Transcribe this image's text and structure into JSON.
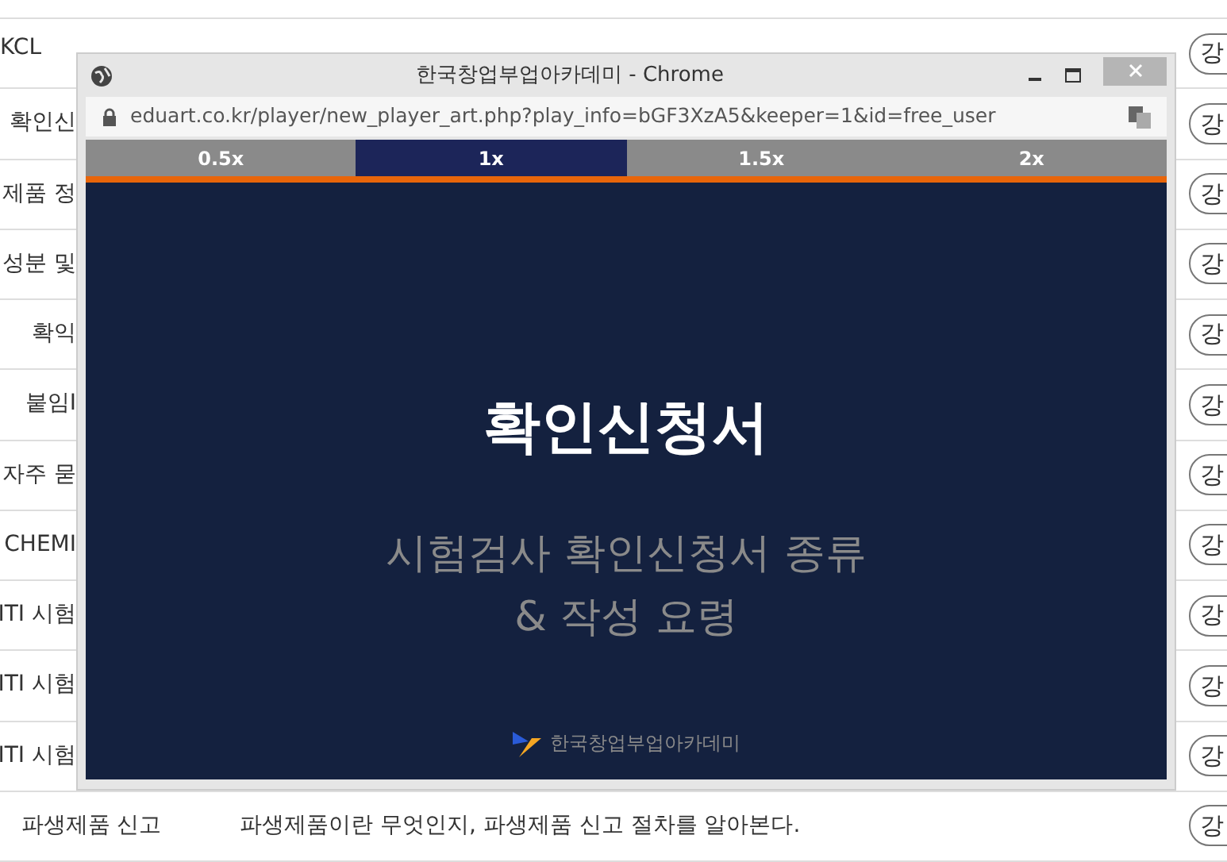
{
  "lessons": [
    {
      "kind": "partial",
      "title": "KCL",
      "button": "강"
    },
    {
      "kind": "covered",
      "title": "확인신",
      "button": "강"
    },
    {
      "kind": "covered",
      "title": "제품 정",
      "button": "강"
    },
    {
      "kind": "covered",
      "title": "성분 및",
      "button": "강"
    },
    {
      "kind": "covered",
      "title": "확익",
      "button": "강"
    },
    {
      "kind": "covered",
      "title": "붙임I",
      "button": "강"
    },
    {
      "kind": "covered",
      "title": "자주 묻",
      "button": "강"
    },
    {
      "kind": "covered",
      "title": "CHEMI",
      "button": "강"
    },
    {
      "kind": "covered",
      "title": "ITI 시험",
      "button": "강"
    },
    {
      "kind": "covered",
      "title": "ITI 시험",
      "button": "강"
    },
    {
      "kind": "covered",
      "title": "ITI 시험",
      "button": "강"
    },
    {
      "kind": "full",
      "title": "파생제품 신고",
      "description": "파생제품이란 무엇인지, 파생제품 신고 절차를 알아본다.",
      "button": "강"
    }
  ],
  "popup": {
    "title": "한국창업부업아카데미 - Chrome",
    "url": "eduart.co.kr/player/new_player_art.php?play_info=bGF3XzA5&keeper=1&id=free_user",
    "speeds": [
      {
        "label": "0.5x",
        "selected": false
      },
      {
        "label": "1x",
        "selected": true
      },
      {
        "label": "1.5x",
        "selected": false
      },
      {
        "label": "2x",
        "selected": false
      }
    ],
    "slide": {
      "heading": "확인신청서",
      "subtitle_lines": [
        "시험검사 확인신청서 종류",
        "& 작성 요령"
      ],
      "logo_text": "한국창업부업아카데미"
    }
  }
}
